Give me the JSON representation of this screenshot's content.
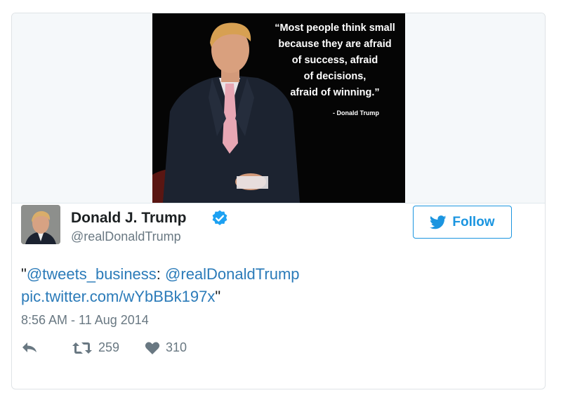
{
  "media": {
    "quote_lines": [
      "“Most people think small",
      "because they are afraid",
      "of success, afraid",
      "of decisions,",
      "afraid of winning.”"
    ],
    "attribution": "- Donald Trump"
  },
  "author": {
    "name": "Donald J. Trump",
    "handle": "@realDonaldTrump",
    "verified": true,
    "avatar_icon": "profile-photo"
  },
  "follow_button": {
    "label": "Follow",
    "icon": "twitter-bird-icon",
    "color": "#1b95e0"
  },
  "tweet": {
    "quote_open": "\"",
    "mention_1": "@tweets_business",
    "separator": ": ",
    "mention_2": "@realDonaldTrump",
    "pic_link": "pic.twitter.com/wYbBBk197x",
    "quote_close": "\""
  },
  "timestamp": "8:56 AM - 11 Aug 2014",
  "actions": {
    "reply_icon": "reply-icon",
    "retweet_icon": "retweet-icon",
    "retweet_count": "259",
    "like_icon": "heart-icon",
    "like_count": "310"
  },
  "colors": {
    "link": "#2b7bb9",
    "text": "#1c2022",
    "muted": "#697882",
    "verified": "#1da1f2"
  }
}
